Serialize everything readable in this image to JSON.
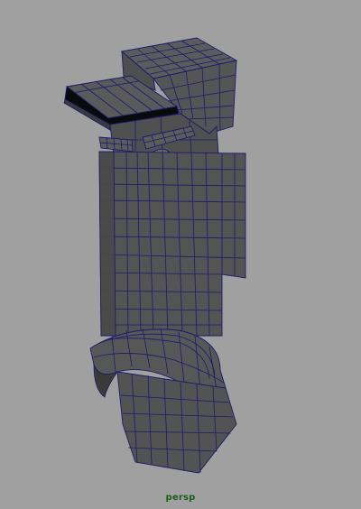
{
  "viewport": {
    "camera_name": "persp",
    "background_color": "#a0a0a0",
    "label_color": "#1a5e1a"
  },
  "model": {
    "surface_color": "#555555",
    "wire_color": "#1c1a6e",
    "shadow_color": "#2e2e2e",
    "underside_color": "#0a0a0a"
  }
}
